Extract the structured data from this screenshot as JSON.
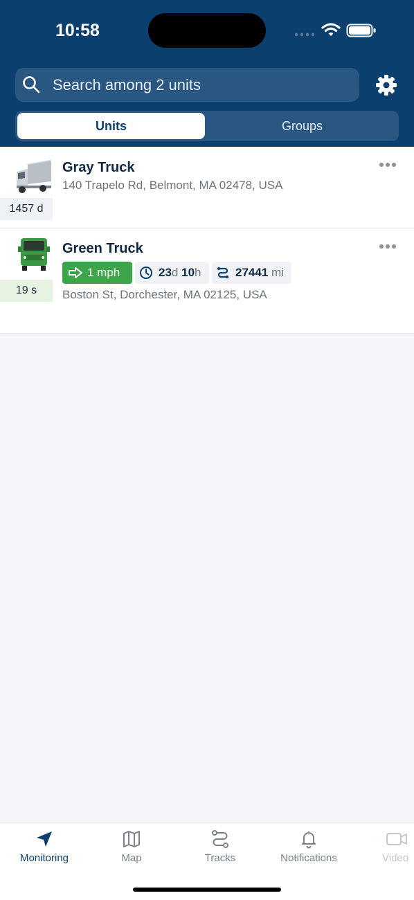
{
  "status_bar": {
    "time": "10:58"
  },
  "search": {
    "placeholder": "Search among 2 units"
  },
  "segments": {
    "units": "Units",
    "groups": "Groups"
  },
  "units": [
    {
      "name": "Gray Truck",
      "address": "140 Trapelo Rd, Belmont, MA 02478, USA",
      "age": "1457 d",
      "icon": "gray-truck-icon"
    },
    {
      "name": "Green Truck",
      "address": "Boston St, Dorchester, MA 02125, USA",
      "age": "19 s",
      "icon": "green-truck-icon",
      "speed": "1 mph",
      "duration_days": "23",
      "duration_days_unit": "d",
      "duration_hours": "10",
      "duration_hours_unit": "h",
      "mileage": "27441",
      "mileage_unit": "mi"
    }
  ],
  "tabs": [
    {
      "label": "Monitoring",
      "icon": "navigation-arrow-icon"
    },
    {
      "label": "Map",
      "icon": "map-icon"
    },
    {
      "label": "Tracks",
      "icon": "route-icon"
    },
    {
      "label": "Notifications",
      "icon": "bell-icon"
    },
    {
      "label": "Video",
      "icon": "video-camera-icon"
    }
  ],
  "colors": {
    "header": "#0a3f6e",
    "speed_chip": "#3ea44a",
    "accent": "#0a3f6e"
  }
}
